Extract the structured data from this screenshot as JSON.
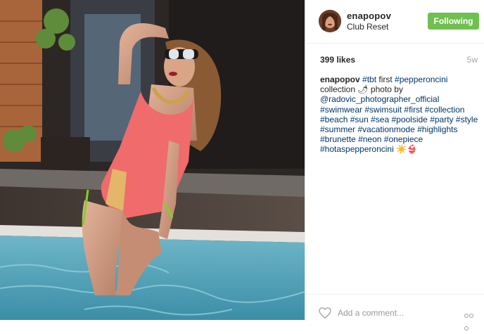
{
  "post": {
    "username": "enapopov",
    "location": "Club Reset",
    "follow_button": "Following",
    "likes": "399 likes",
    "time_ago": "5w",
    "caption": {
      "username": "enapopov",
      "lines": [
        [
          {
            "t": "tag",
            "v": "#tbt"
          },
          {
            "t": "text",
            "v": " first "
          },
          {
            "t": "tag",
            "v": "#pepperoncini"
          }
        ],
        [
          {
            "t": "text",
            "v": "collection 🌶 photo by"
          }
        ],
        [
          {
            "t": "tag",
            "v": "@radovic_photographer_official"
          }
        ],
        [
          {
            "t": "tag",
            "v": "#swimwear"
          },
          {
            "t": "text",
            "v": " "
          },
          {
            "t": "tag",
            "v": "#swimsuit"
          },
          {
            "t": "text",
            "v": " "
          },
          {
            "t": "tag",
            "v": "#first"
          },
          {
            "t": "text",
            "v": " "
          },
          {
            "t": "tag",
            "v": "#collection"
          }
        ],
        [
          {
            "t": "tag",
            "v": "#beach"
          },
          {
            "t": "text",
            "v": " "
          },
          {
            "t": "tag",
            "v": "#sun"
          },
          {
            "t": "text",
            "v": " "
          },
          {
            "t": "tag",
            "v": "#sea"
          },
          {
            "t": "text",
            "v": " "
          },
          {
            "t": "tag",
            "v": "#poolside"
          },
          {
            "t": "text",
            "v": " "
          },
          {
            "t": "tag",
            "v": "#party"
          },
          {
            "t": "text",
            "v": " "
          },
          {
            "t": "tag",
            "v": "#style"
          }
        ],
        [
          {
            "t": "tag",
            "v": "#summer"
          },
          {
            "t": "text",
            "v": " "
          },
          {
            "t": "tag",
            "v": "#vacationmode"
          },
          {
            "t": "text",
            "v": " "
          },
          {
            "t": "tag",
            "v": "#highlights"
          }
        ],
        [
          {
            "t": "tag",
            "v": "#brunette"
          },
          {
            "t": "text",
            "v": " "
          },
          {
            "t": "tag",
            "v": "#neon"
          },
          {
            "t": "text",
            "v": " "
          },
          {
            "t": "tag",
            "v": "#onepiece"
          }
        ],
        [
          {
            "t": "tag",
            "v": "#hotaspepperoncini"
          },
          {
            "t": "text",
            "v": " ☀️👙"
          }
        ]
      ]
    },
    "comment_placeholder": "Add a comment...",
    "icons": {
      "like": "heart-icon",
      "more": "more-options-icon",
      "avatar": "avatar",
      "photo": "post-photo"
    },
    "colors": {
      "follow_button": "#70c050",
      "hashtag": "#003569",
      "timestamp": "#a5a7aa",
      "divider": "#efefef"
    }
  }
}
